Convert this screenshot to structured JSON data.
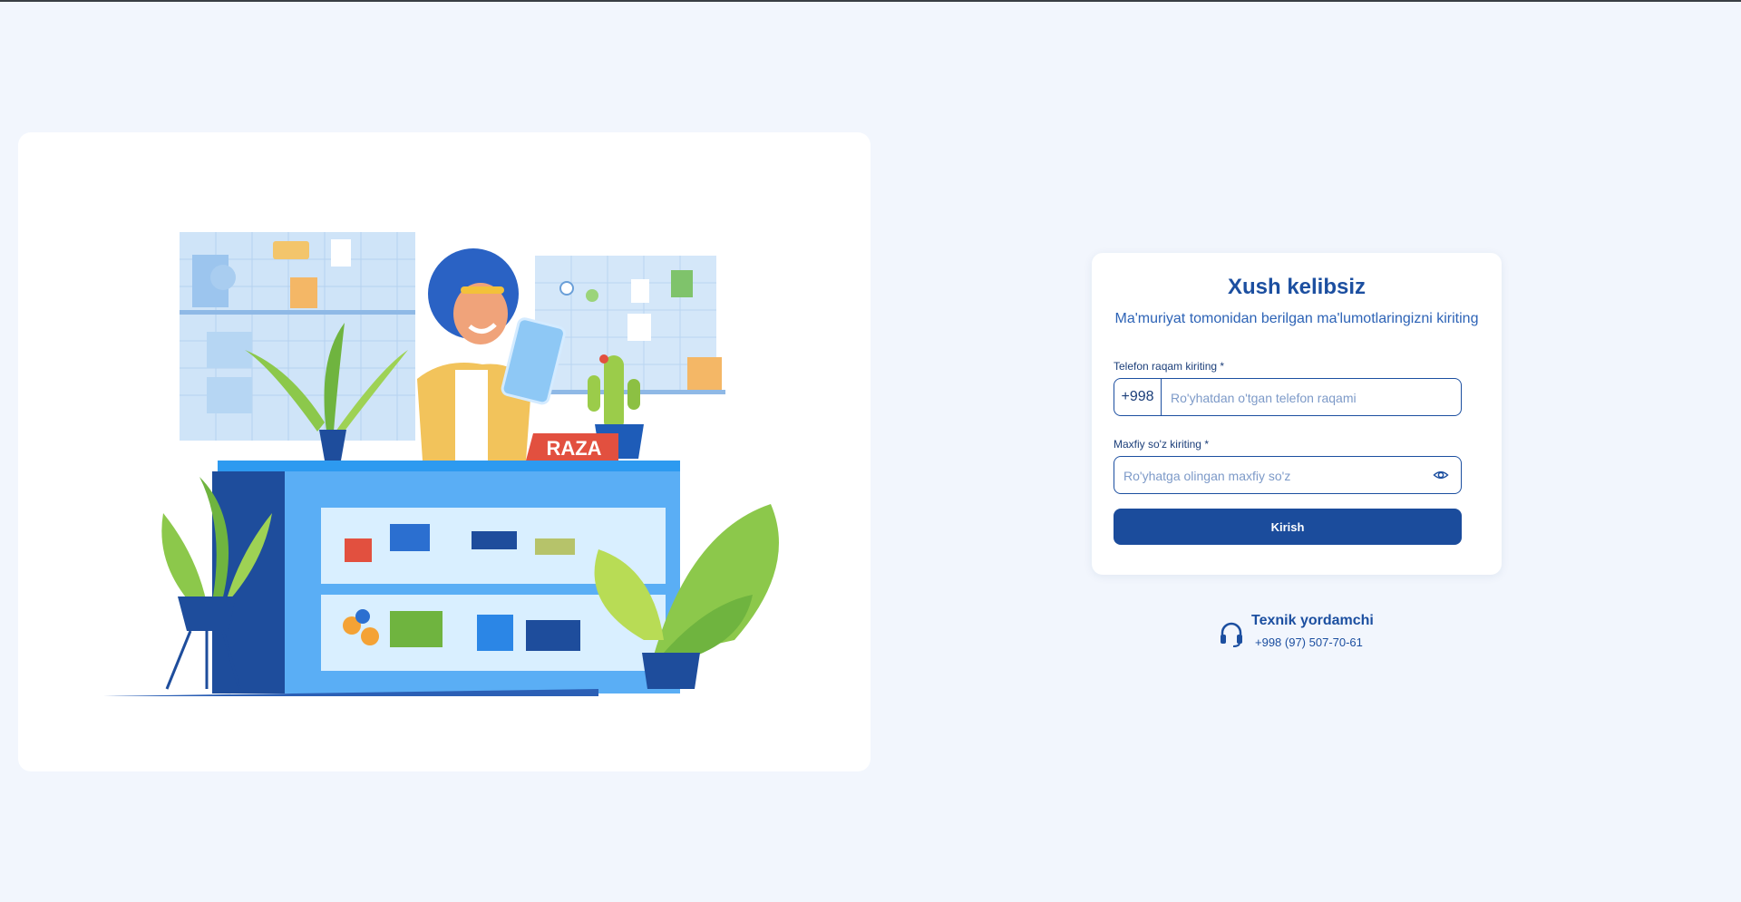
{
  "login": {
    "title": "Xush kelibsiz",
    "subtitle": "Ma'muriyat tomonidan berilgan ma'lumotlaringizni kiriting",
    "phone_label": "Telefon raqam kiriting *",
    "phone_prefix": "+998",
    "phone_placeholder": "Ro'yhatdan o'tgan telefon raqami",
    "password_label": "Maxfiy so'z kiriting *",
    "password_placeholder": "Ro'yhatga olingan maxfiy so'z",
    "submit_label": "Kirish"
  },
  "support": {
    "title": "Texnik yordamchi",
    "phone": "+998 (97) 507-70-61"
  },
  "illustration": {
    "sign_text": "RAZA"
  },
  "colors": {
    "primary": "#1b4c9c",
    "background": "#f2f6fd",
    "accent_red": "#e2503f"
  },
  "icons": {
    "password_toggle": "eye-icon",
    "support": "headset-icon"
  }
}
